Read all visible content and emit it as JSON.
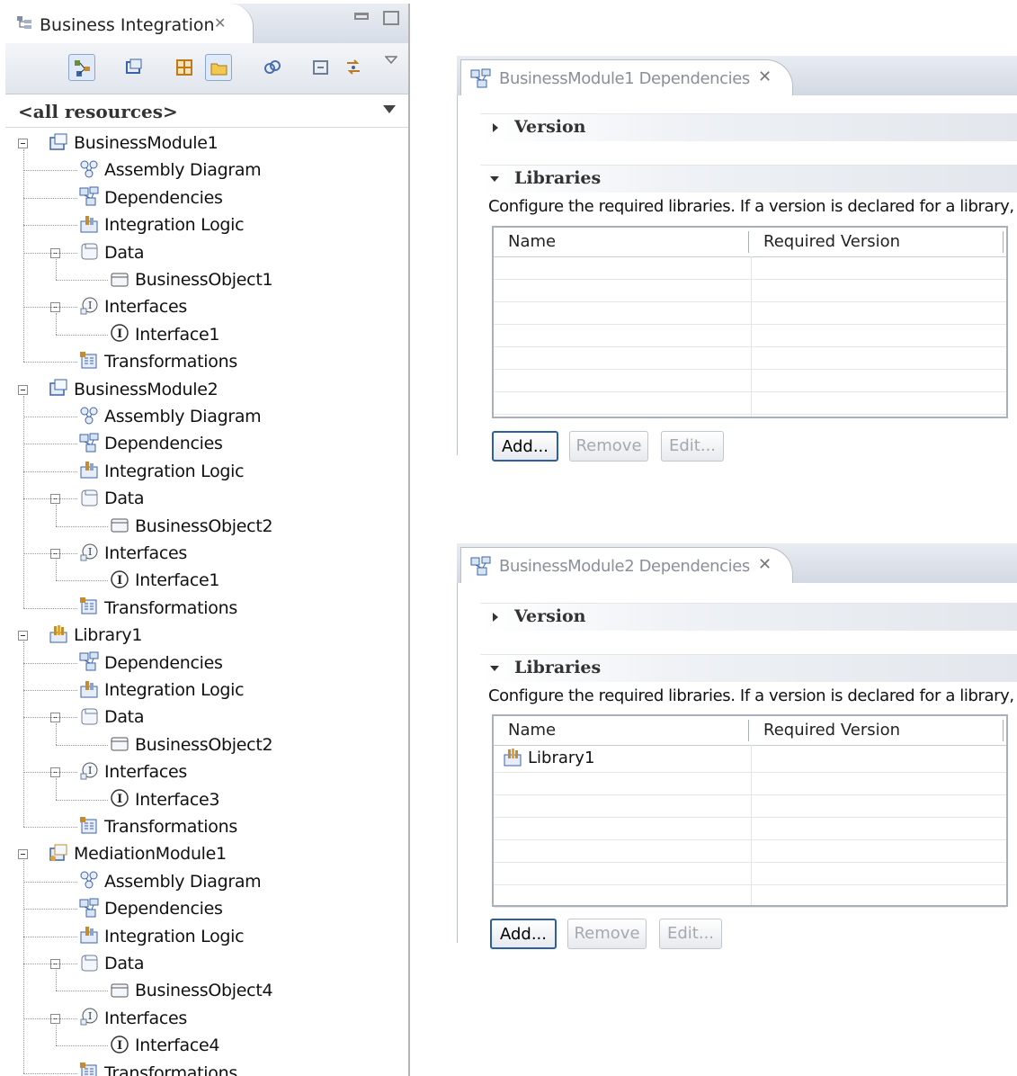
{
  "explorer": {
    "title": "Business Integration",
    "filter": "<all resources>",
    "tree": [
      {
        "label": "BusinessModule1",
        "depth": 0,
        "icon": "module-icon",
        "expanded": true
      },
      {
        "label": "Assembly Diagram",
        "depth": 1,
        "icon": "assembly-diagram-icon"
      },
      {
        "label": "Dependencies",
        "depth": 1,
        "icon": "dependencies-icon"
      },
      {
        "label": "Integration Logic",
        "depth": 1,
        "icon": "integration-logic-icon"
      },
      {
        "label": "Data",
        "depth": 1,
        "icon": "data-icon",
        "expanded": true
      },
      {
        "label": "BusinessObject1",
        "depth": 2,
        "icon": "business-object-icon"
      },
      {
        "label": "Interfaces",
        "depth": 1,
        "icon": "interfaces-icon",
        "expanded": true
      },
      {
        "label": "Interface1",
        "depth": 2,
        "icon": "interface-icon"
      },
      {
        "label": "Transformations",
        "depth": 1,
        "icon": "transformations-icon"
      },
      {
        "label": "BusinessModule2",
        "depth": 0,
        "icon": "module-icon",
        "expanded": true
      },
      {
        "label": "Assembly Diagram",
        "depth": 1,
        "icon": "assembly-diagram-icon"
      },
      {
        "label": "Dependencies",
        "depth": 1,
        "icon": "dependencies-icon"
      },
      {
        "label": "Integration Logic",
        "depth": 1,
        "icon": "integration-logic-icon"
      },
      {
        "label": "Data",
        "depth": 1,
        "icon": "data-icon",
        "expanded": true
      },
      {
        "label": "BusinessObject2",
        "depth": 2,
        "icon": "business-object-icon"
      },
      {
        "label": "Interfaces",
        "depth": 1,
        "icon": "interfaces-icon",
        "expanded": true
      },
      {
        "label": "Interface1",
        "depth": 2,
        "icon": "interface-icon"
      },
      {
        "label": "Transformations",
        "depth": 1,
        "icon": "transformations-icon"
      },
      {
        "label": "Library1",
        "depth": 0,
        "icon": "library-icon",
        "expanded": true
      },
      {
        "label": "Dependencies",
        "depth": 1,
        "icon": "dependencies-icon"
      },
      {
        "label": "Integration Logic",
        "depth": 1,
        "icon": "integration-logic-icon"
      },
      {
        "label": "Data",
        "depth": 1,
        "icon": "data-icon",
        "expanded": true
      },
      {
        "label": "BusinessObject2",
        "depth": 2,
        "icon": "business-object-icon"
      },
      {
        "label": "Interfaces",
        "depth": 1,
        "icon": "interfaces-icon",
        "expanded": true
      },
      {
        "label": "Interface3",
        "depth": 2,
        "icon": "interface-icon"
      },
      {
        "label": "Transformations",
        "depth": 1,
        "icon": "transformations-icon"
      },
      {
        "label": "MediationModule1",
        "depth": 0,
        "icon": "mediation-module-icon",
        "expanded": true
      },
      {
        "label": "Assembly Diagram",
        "depth": 1,
        "icon": "assembly-diagram-icon"
      },
      {
        "label": "Dependencies",
        "depth": 1,
        "icon": "dependencies-icon"
      },
      {
        "label": "Integration Logic",
        "depth": 1,
        "icon": "integration-logic-icon"
      },
      {
        "label": "Data",
        "depth": 1,
        "icon": "data-icon",
        "expanded": true
      },
      {
        "label": "BusinessObject4",
        "depth": 2,
        "icon": "business-object-icon"
      },
      {
        "label": "Interfaces",
        "depth": 1,
        "icon": "interfaces-icon",
        "expanded": true
      },
      {
        "label": "Interface4",
        "depth": 2,
        "icon": "interface-icon"
      },
      {
        "label": "Transformations",
        "depth": 1,
        "icon": "transformations-icon"
      }
    ]
  },
  "editors": [
    {
      "title": "BusinessModule1 Dependencies",
      "version_label": "Version",
      "libraries_label": "Libraries",
      "description": "Configure the required libraries.  If a version is declared for a library,",
      "columns": [
        "Name",
        "Required Version"
      ],
      "rows": [],
      "buttons": {
        "add": "Add...",
        "remove": "Remove",
        "edit": "Edit..."
      }
    },
    {
      "title": "BusinessModule2 Dependencies",
      "version_label": "Version",
      "libraries_label": "Libraries",
      "description": "Configure the required libraries.  If a version is declared for a library,",
      "columns": [
        "Name",
        "Required Version"
      ],
      "rows": [
        {
          "name": "Library1",
          "version": ""
        }
      ],
      "buttons": {
        "add": "Add...",
        "remove": "Remove",
        "edit": "Edit..."
      }
    }
  ]
}
